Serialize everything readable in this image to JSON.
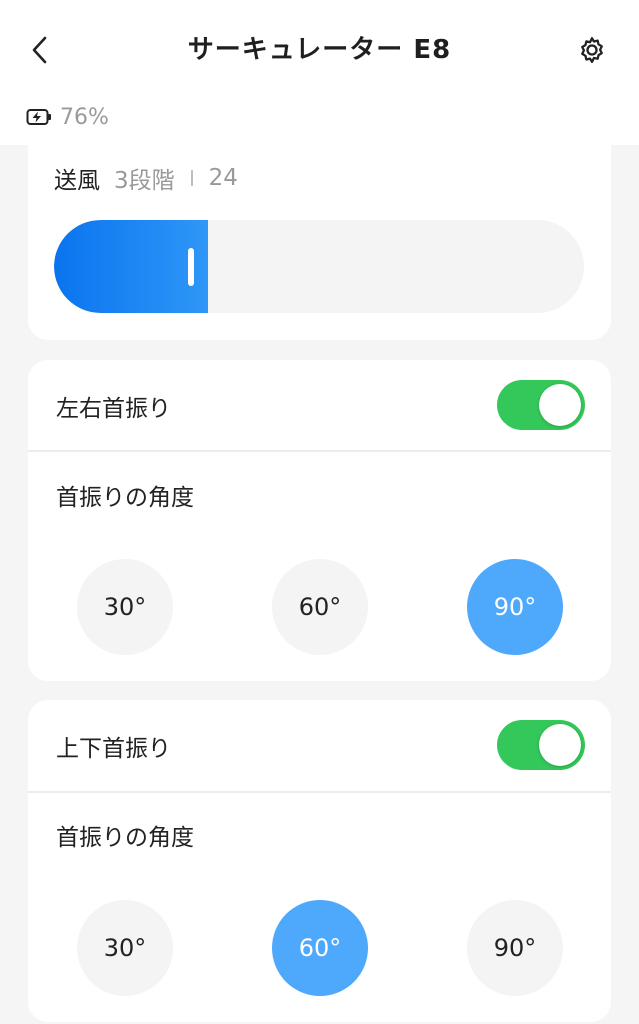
{
  "header": {
    "title": "サーキュレーター E8",
    "back_icon": "chevron-left-icon",
    "settings_icon": "gear-icon"
  },
  "battery": {
    "icon": "battery-charging-icon",
    "percent_text": "76%"
  },
  "fan": {
    "label": "送風",
    "level": "3段階",
    "value": "24",
    "fill_percent": 29,
    "fill_color": "#0a74ef"
  },
  "horizontal_swing": {
    "label": "左右首振り",
    "enabled": true,
    "angle_label": "首振りの角度",
    "options": [
      "30°",
      "60°",
      "90°"
    ],
    "selected": "90°"
  },
  "vertical_swing": {
    "label": "上下首振り",
    "enabled": true,
    "angle_label": "首振りの角度",
    "options": [
      "30°",
      "60°",
      "90°"
    ],
    "selected": "60°"
  },
  "colors": {
    "toggle_on": "#34c759",
    "angle_active": "#4ea8fb"
  }
}
